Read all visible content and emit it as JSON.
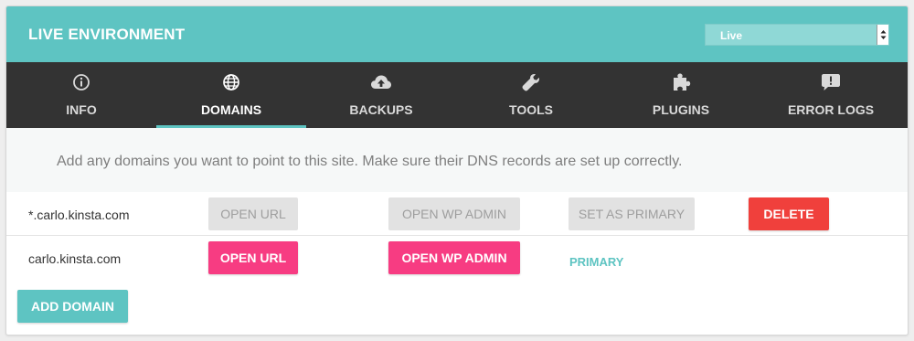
{
  "header": {
    "title": "LIVE ENVIRONMENT",
    "env_select_value": "Live"
  },
  "tabs": [
    {
      "label": "INFO",
      "icon": "info-icon"
    },
    {
      "label": "DOMAINS",
      "icon": "globe-icon",
      "active": true
    },
    {
      "label": "BACKUPS",
      "icon": "cloud-upload-icon"
    },
    {
      "label": "TOOLS",
      "icon": "wrench-icon"
    },
    {
      "label": "PLUGINS",
      "icon": "puzzle-icon"
    },
    {
      "label": "ERROR LOGS",
      "icon": "alert-comment-icon"
    }
  ],
  "info_text": "Add any domains you want to point to this site. Make sure their DNS records are set up correctly.",
  "domains": [
    {
      "name": "*.carlo.kinsta.com",
      "open_url": "OPEN URL",
      "open_wp_admin": "OPEN WP ADMIN",
      "set_primary": "SET AS PRIMARY",
      "delete": "DELETE"
    },
    {
      "name": "carlo.kinsta.com",
      "open_url": "OPEN URL",
      "open_wp_admin": "OPEN WP ADMIN",
      "primary_label": "PRIMARY"
    }
  ],
  "add_domain_label": "ADD DOMAIN",
  "colors": {
    "accent_teal": "#5ec4c2",
    "tab_bar": "#333333",
    "pink": "#f73c82",
    "red": "#f0403c",
    "disabled_gray": "#e2e2e2"
  }
}
